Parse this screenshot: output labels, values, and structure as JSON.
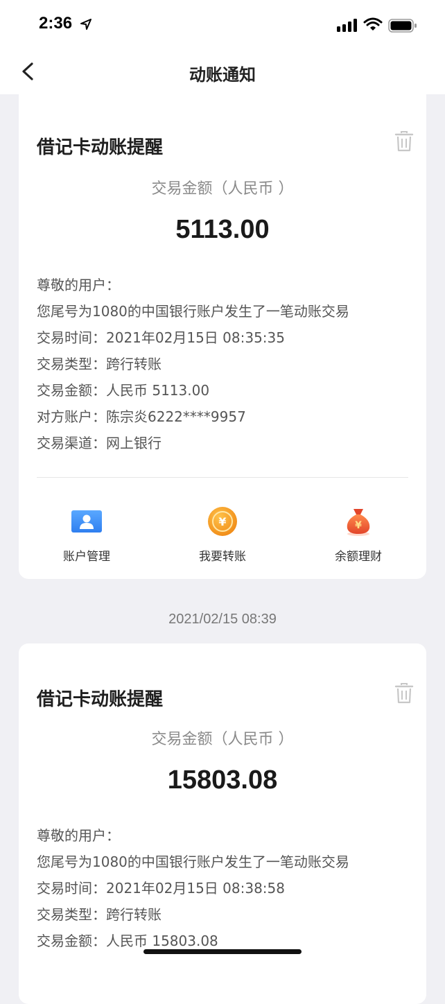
{
  "status_bar": {
    "time": "2:36"
  },
  "nav": {
    "title": "动账通知"
  },
  "notifications": [
    {
      "title": "借记卡动账提醒",
      "amount_label": "交易金额（人民币 ）",
      "amount": "5113.00",
      "lines": [
        "尊敬的用户：",
        "您尾号为1080的中国银行账户发生了一笔动账交易",
        "交易时间：2021年02月15日 08:35:35",
        "交易类型：跨行转账",
        "交易金额：人民币 5113.00",
        "对方账户：陈宗炎6222****9957",
        "交易渠道：网上银行"
      ],
      "actions": [
        {
          "label": "账户管理",
          "icon": "account-icon"
        },
        {
          "label": "我要转账",
          "icon": "transfer-coin-icon"
        },
        {
          "label": "余额理财",
          "icon": "money-bag-icon"
        }
      ]
    },
    {
      "timestamp": "2021/02/15 08:39",
      "title": "借记卡动账提醒",
      "amount_label": "交易金额（人民币 ）",
      "amount": "15803.08",
      "lines": [
        "尊敬的用户：",
        "您尾号为1080的中国银行账户发生了一笔动账交易",
        "交易时间：2021年02月15日 08:38:58",
        "交易类型：跨行转账",
        "交易金额：人民币 15803.08"
      ]
    }
  ],
  "colors": {
    "background": "#f0f0f4",
    "card": "#ffffff",
    "account_icon_blue": "#3a8ef6",
    "coin_orange": "#f59a23",
    "bag_red": "#e8562f"
  }
}
